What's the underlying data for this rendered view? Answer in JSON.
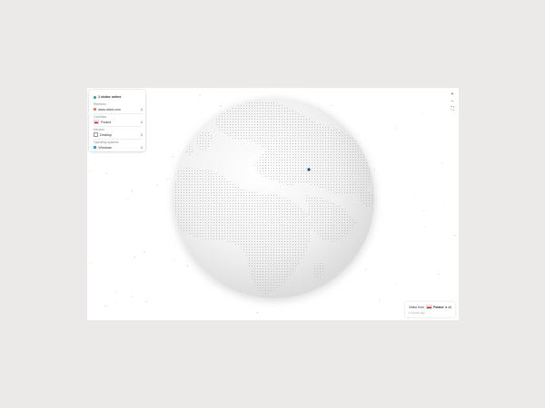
{
  "panel": {
    "online_text": "1 visitor online",
    "sections": [
      {
        "label": "Referrers",
        "value": "www.rickst.com",
        "count": "1",
        "icon": "referrer-icon"
      },
      {
        "label": "Countries",
        "value": "Poland",
        "count": "1",
        "icon": "poland-flag-icon"
      },
      {
        "label": "Devices",
        "value": "Desktop",
        "count": "1",
        "icon": "desktop-icon"
      },
      {
        "label": "Operating systems",
        "value": "Windows",
        "count": "1",
        "icon": "windows-icon"
      }
    ]
  },
  "controls": {
    "zoom_in": "+",
    "zoom_out": "−",
    "fullscreen": "⛶"
  },
  "toast": {
    "prefix": "Visitor from",
    "country": "Poland",
    "suffix": "is on",
    "time": "1 minute ago",
    "menu": "⋮"
  },
  "colors": {
    "online": "#2fa173",
    "visitor_marker": "#1a5276",
    "globe": "#f1f1f1",
    "land_dots": "#b9b9b9"
  }
}
